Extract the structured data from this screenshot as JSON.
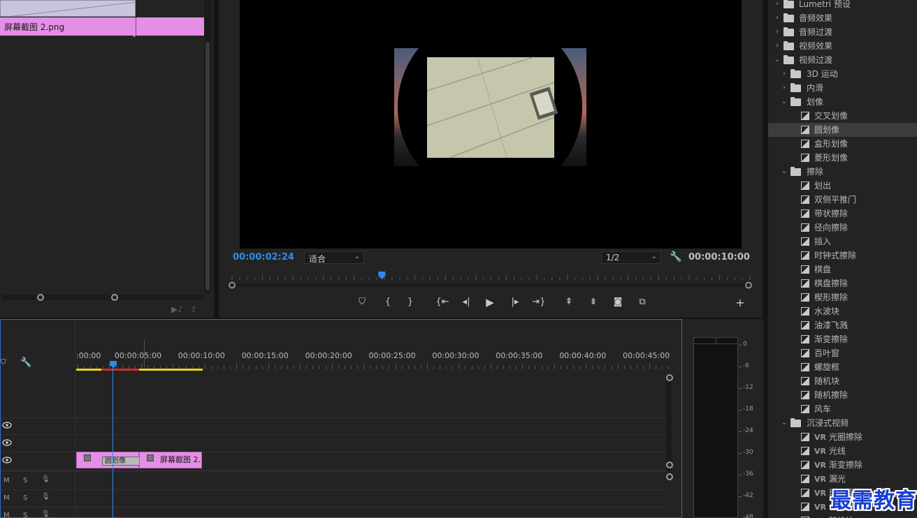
{
  "project": {
    "clip_name": "屏幕截图 2.png"
  },
  "monitor": {
    "current_time": "00:00:02:24",
    "zoom": "适合",
    "resolution": "1/2",
    "duration": "00:00:10:00",
    "playhead_fraction": 0.29
  },
  "effects": {
    "items": [
      {
        "level": 0,
        "kind": "folder",
        "open": false,
        "label": "Lumetri 预设"
      },
      {
        "level": 0,
        "kind": "folder",
        "open": false,
        "label": "音频效果"
      },
      {
        "level": 0,
        "kind": "folder",
        "open": false,
        "label": "音频过渡"
      },
      {
        "level": 0,
        "kind": "folder",
        "open": false,
        "label": "视频效果"
      },
      {
        "level": 0,
        "kind": "folder",
        "open": true,
        "label": "视频过渡"
      },
      {
        "level": 1,
        "kind": "folder",
        "open": false,
        "label": "3D 运动"
      },
      {
        "level": 1,
        "kind": "folder",
        "open": false,
        "label": "内滑"
      },
      {
        "level": 1,
        "kind": "folder",
        "open": true,
        "label": "划像"
      },
      {
        "level": 2,
        "kind": "effect",
        "label": "交叉划像"
      },
      {
        "level": 2,
        "kind": "effect",
        "label": "圆划像",
        "selected": true
      },
      {
        "level": 2,
        "kind": "effect",
        "label": "盒形划像"
      },
      {
        "level": 2,
        "kind": "effect",
        "label": "菱形划像"
      },
      {
        "level": 1,
        "kind": "folder",
        "open": true,
        "label": "擦除"
      },
      {
        "level": 2,
        "kind": "effect",
        "label": "划出"
      },
      {
        "level": 2,
        "kind": "effect",
        "label": "双侧平推门"
      },
      {
        "level": 2,
        "kind": "effect",
        "label": "带状擦除"
      },
      {
        "level": 2,
        "kind": "effect",
        "label": "径向擦除"
      },
      {
        "level": 2,
        "kind": "effect",
        "label": "插入"
      },
      {
        "level": 2,
        "kind": "effect",
        "label": "时钟式擦除"
      },
      {
        "level": 2,
        "kind": "effect",
        "label": "棋盘"
      },
      {
        "level": 2,
        "kind": "effect",
        "label": "棋盘擦除"
      },
      {
        "level": 2,
        "kind": "effect",
        "label": "楔形擦除"
      },
      {
        "level": 2,
        "kind": "effect",
        "label": "水波块"
      },
      {
        "level": 2,
        "kind": "effect",
        "label": "油漆飞溅"
      },
      {
        "level": 2,
        "kind": "effect",
        "label": "渐变擦除"
      },
      {
        "level": 2,
        "kind": "effect",
        "label": "百叶窗"
      },
      {
        "level": 2,
        "kind": "effect",
        "label": "螺旋框"
      },
      {
        "level": 2,
        "kind": "effect",
        "label": "随机块"
      },
      {
        "level": 2,
        "kind": "effect",
        "label": "随机擦除"
      },
      {
        "level": 2,
        "kind": "effect",
        "label": "风车"
      },
      {
        "level": 1,
        "kind": "folder",
        "open": true,
        "label": "沉浸式视频"
      },
      {
        "level": 2,
        "kind": "effect",
        "vr": true,
        "label": "光圈擦除"
      },
      {
        "level": 2,
        "kind": "effect",
        "vr": true,
        "label": "光线"
      },
      {
        "level": 2,
        "kind": "effect",
        "vr": true,
        "label": "渐变擦除"
      },
      {
        "level": 2,
        "kind": "effect",
        "vr": true,
        "label": "漏光"
      },
      {
        "level": 2,
        "kind": "effect",
        "vr": true,
        "label": "球形模糊"
      },
      {
        "level": 2,
        "kind": "effect",
        "vr": true,
        "label": "色度泄漏"
      },
      {
        "level": 2,
        "kind": "effect",
        "vr": true,
        "label": "随机块"
      }
    ],
    "vr_tag": "VR"
  },
  "timeline": {
    "ruler": [
      ":00:00",
      "00:00:05:00",
      "00:00:10:00",
      "00:00:15:00",
      "00:00:20:00",
      "00:00:25:00",
      "00:00:30:00",
      "00:00:35:00",
      "00:00:40:00",
      "00:00:45:00"
    ],
    "transition_label": "圆划像",
    "clip_label": "屏幕截图 2.",
    "audio_labels": {
      "mute": "M",
      "solo": "S"
    }
  },
  "meter": {
    "scale": [
      "0",
      "-6",
      "-12",
      "-18",
      "-24",
      "-30",
      "-36",
      "-42",
      "-48"
    ]
  },
  "watermark": "最需教育",
  "colors": {
    "accent": "#2d8ceb",
    "clip": "#e48ee6",
    "panel": "#232323",
    "watermark": "#1a3fd0"
  }
}
